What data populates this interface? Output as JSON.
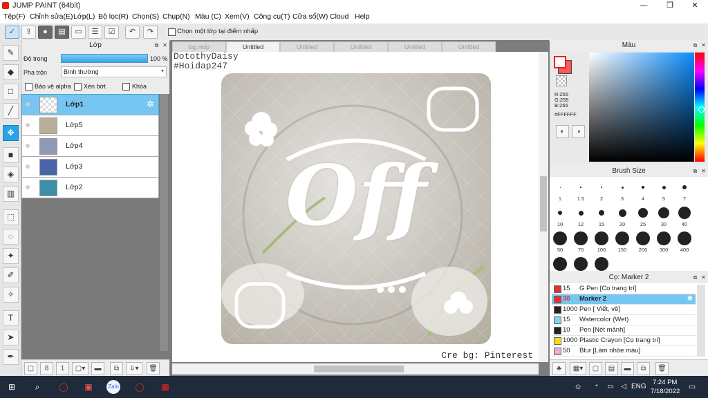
{
  "window": {
    "title": "JUMP PAINT (64bit)",
    "controls": [
      "—",
      "❐",
      "✕"
    ]
  },
  "menu": [
    "Tệp(F)",
    "Chỉnh sửa(E)",
    "Lớp(L)",
    "Bộ lọc(R)",
    "Chọn(S)",
    "Chụp(N)",
    "Màu (C)",
    "Xem(V)",
    "Công cụ(T)",
    "Cửa sổ(W)",
    "Cloud",
    "Help"
  ],
  "toolbar": {
    "select_layer_checkbox": "Chọn một lớp tại điểm nhấp"
  },
  "layer_panel": {
    "title": "Lớp",
    "opacity_label": "Độ trong",
    "opacity_value": "100 %",
    "blend_label": "Pha trộn",
    "blend_value": "Bình thường",
    "protect_alpha": "Bảo vệ alpha",
    "clipping": "Xén bớt",
    "lock": "Khóa",
    "layers": [
      "Lớp1",
      "Lớp5",
      "Lớp4",
      "Lớp3",
      "Lớp2"
    ]
  },
  "canvas": {
    "tabs": [
      "bg.mdp",
      "Untitled",
      "Untitled",
      "Untitled",
      "Untitled",
      "Untitled"
    ],
    "watermark_line1": "DotothyDaisy",
    "watermark_line2": "#Hoidap247",
    "credit": "Cre bg: Pinterest",
    "art_text": "Off"
  },
  "color_panel": {
    "title": "Màu",
    "r": "R:255",
    "g": "G:255",
    "b": "B:255",
    "hex": "#FFFFFF",
    "fg_color": "#ffffff",
    "bg_color": "#ff3b3b"
  },
  "brush_size_panel": {
    "title": "Brush Size",
    "sizes": [
      "1",
      "1.5",
      "2",
      "3",
      "4",
      "5",
      "7",
      "10",
      "12",
      "15",
      "20",
      "25",
      "30",
      "40",
      "50",
      "70",
      "100",
      "150",
      "200",
      "300",
      "400"
    ]
  },
  "brush_panel": {
    "title": "Cọ: Marker 2",
    "brushes": [
      {
        "size": "15",
        "name": "G Pen [Cọ trang trí]",
        "color": "#e53030"
      },
      {
        "size": "30",
        "name": "Marker 2",
        "color": "#e53030"
      },
      {
        "size": "1000",
        "name": "Pen [ Viết, vẽ]",
        "color": "#222222"
      },
      {
        "size": "15",
        "name": "Watercolor (Wet)",
        "color": "#7fd3ef"
      },
      {
        "size": "10",
        "name": "Pen [Nét mảnh]",
        "color": "#222222"
      },
      {
        "size": "1000",
        "name": "Plastic Crayon [Cọ trang trí]",
        "color": "#f2dd17"
      },
      {
        "size": "50",
        "name": "Blur [Làm nhòe màu]",
        "color": "#f2a8d6"
      }
    ]
  },
  "taskbar": {
    "lang": "ENG",
    "time": "7:24 PM",
    "date": "7/18/2022"
  }
}
